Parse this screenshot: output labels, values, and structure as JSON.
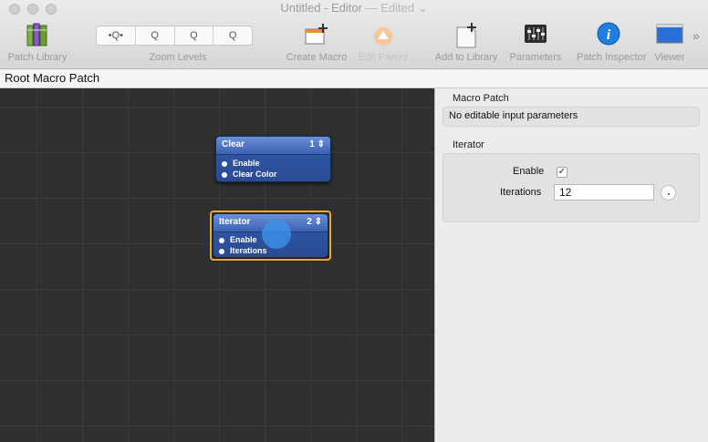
{
  "window": {
    "title": "Untitled - Editor",
    "status": "— Edited",
    "status_chevron": "⌄"
  },
  "toolbar": {
    "patch_library": "Patch Library",
    "zoom_levels": "Zoom Levels",
    "zoom_buttons": [
      "•Q•",
      "Q",
      "Q",
      "Q"
    ],
    "create_macro": "Create Macro",
    "edit_parent": "Edit Parent",
    "add_to_library": "Add to Library",
    "parameters": "Parameters",
    "patch_inspector": "Patch Inspector",
    "viewer": "Viewer",
    "overflow": "»"
  },
  "breadcrumb": "Root Macro Patch",
  "patches": [
    {
      "name": "Clear",
      "number": "1",
      "ports": [
        "Enable",
        "Clear Color"
      ]
    },
    {
      "name": "Iterator",
      "number": "2",
      "ports": [
        "Enable",
        "Iterations"
      ]
    }
  ],
  "inspector": {
    "macro_section": "Macro Patch",
    "macro_note": "No editable input parameters",
    "iterator_section": "Iterator",
    "enable_label": "Enable",
    "enable_checked": "✓",
    "iterations_label": "Iterations",
    "iterations_value": "12"
  },
  "colors": {
    "patch_blue": "#2f55a2",
    "selection_orange": "#f3a62a",
    "canvas_bg": "#2f2f2f"
  }
}
